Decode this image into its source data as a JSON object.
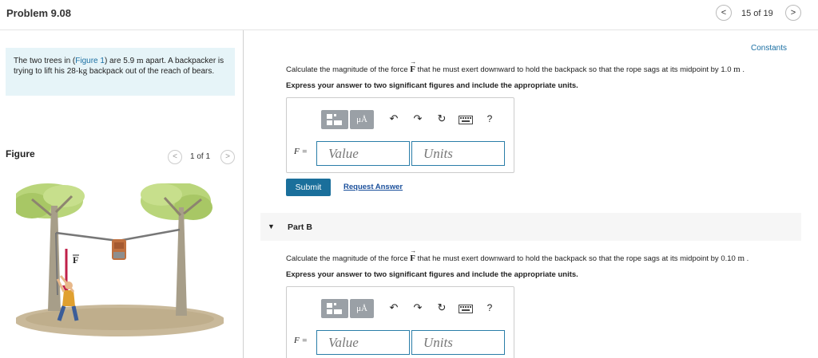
{
  "header": {
    "title": "Problem 9.08",
    "prev_icon": "<",
    "next_icon": ">",
    "page_count": "15 of 19"
  },
  "problem": {
    "text_before_link": "The two trees in (",
    "figure_link": "Figure 1",
    "text_after_link": ") are 5.9 ",
    "distance_unit": "m",
    "text_mid": " apart. A backpacker is trying to lift his 28-",
    "mass_unit": "kg",
    "text_end": " backpack out of the reach of bears."
  },
  "figure_panel": {
    "label": "Figure",
    "prev_icon": "<",
    "next_icon": ">",
    "count": "1 of 1",
    "force_label": "F"
  },
  "constants_link": "Constants",
  "part_a": {
    "question_pre": "Calculate the magnitude of the force ",
    "force_symbol": "F",
    "question_post": " that he must exert downward to hold the backpack so that the rope sags at its midpoint by 1.0 ",
    "unit": "m",
    "period": " .",
    "instruction": "Express your answer to two significant figures and include the appropriate units.",
    "f_label": "F =",
    "value_placeholder": "Value",
    "units_placeholder": "Units",
    "submit_label": "Submit",
    "request_label": "Request Answer"
  },
  "part_b": {
    "caret": "▼",
    "title": "Part B",
    "question_pre": "Calculate the magnitude of the force ",
    "force_symbol": "F",
    "question_post": " that he must exert downward to hold the backpack so that the rope sags at its midpoint by 0.10 ",
    "unit": "m",
    "period": " .",
    "instruction": "Express your answer to two significant figures and include the appropriate units.",
    "f_label": "F =",
    "value_placeholder": "Value",
    "units_placeholder": "Units"
  },
  "toolbar": {
    "template_icon": "templates-icon",
    "mu_label": "μÅ",
    "undo_icon": "↶",
    "redo_icon": "↷",
    "reset_icon": "↻",
    "keyboard_icon": "keyboard-icon",
    "help_icon": "?"
  }
}
